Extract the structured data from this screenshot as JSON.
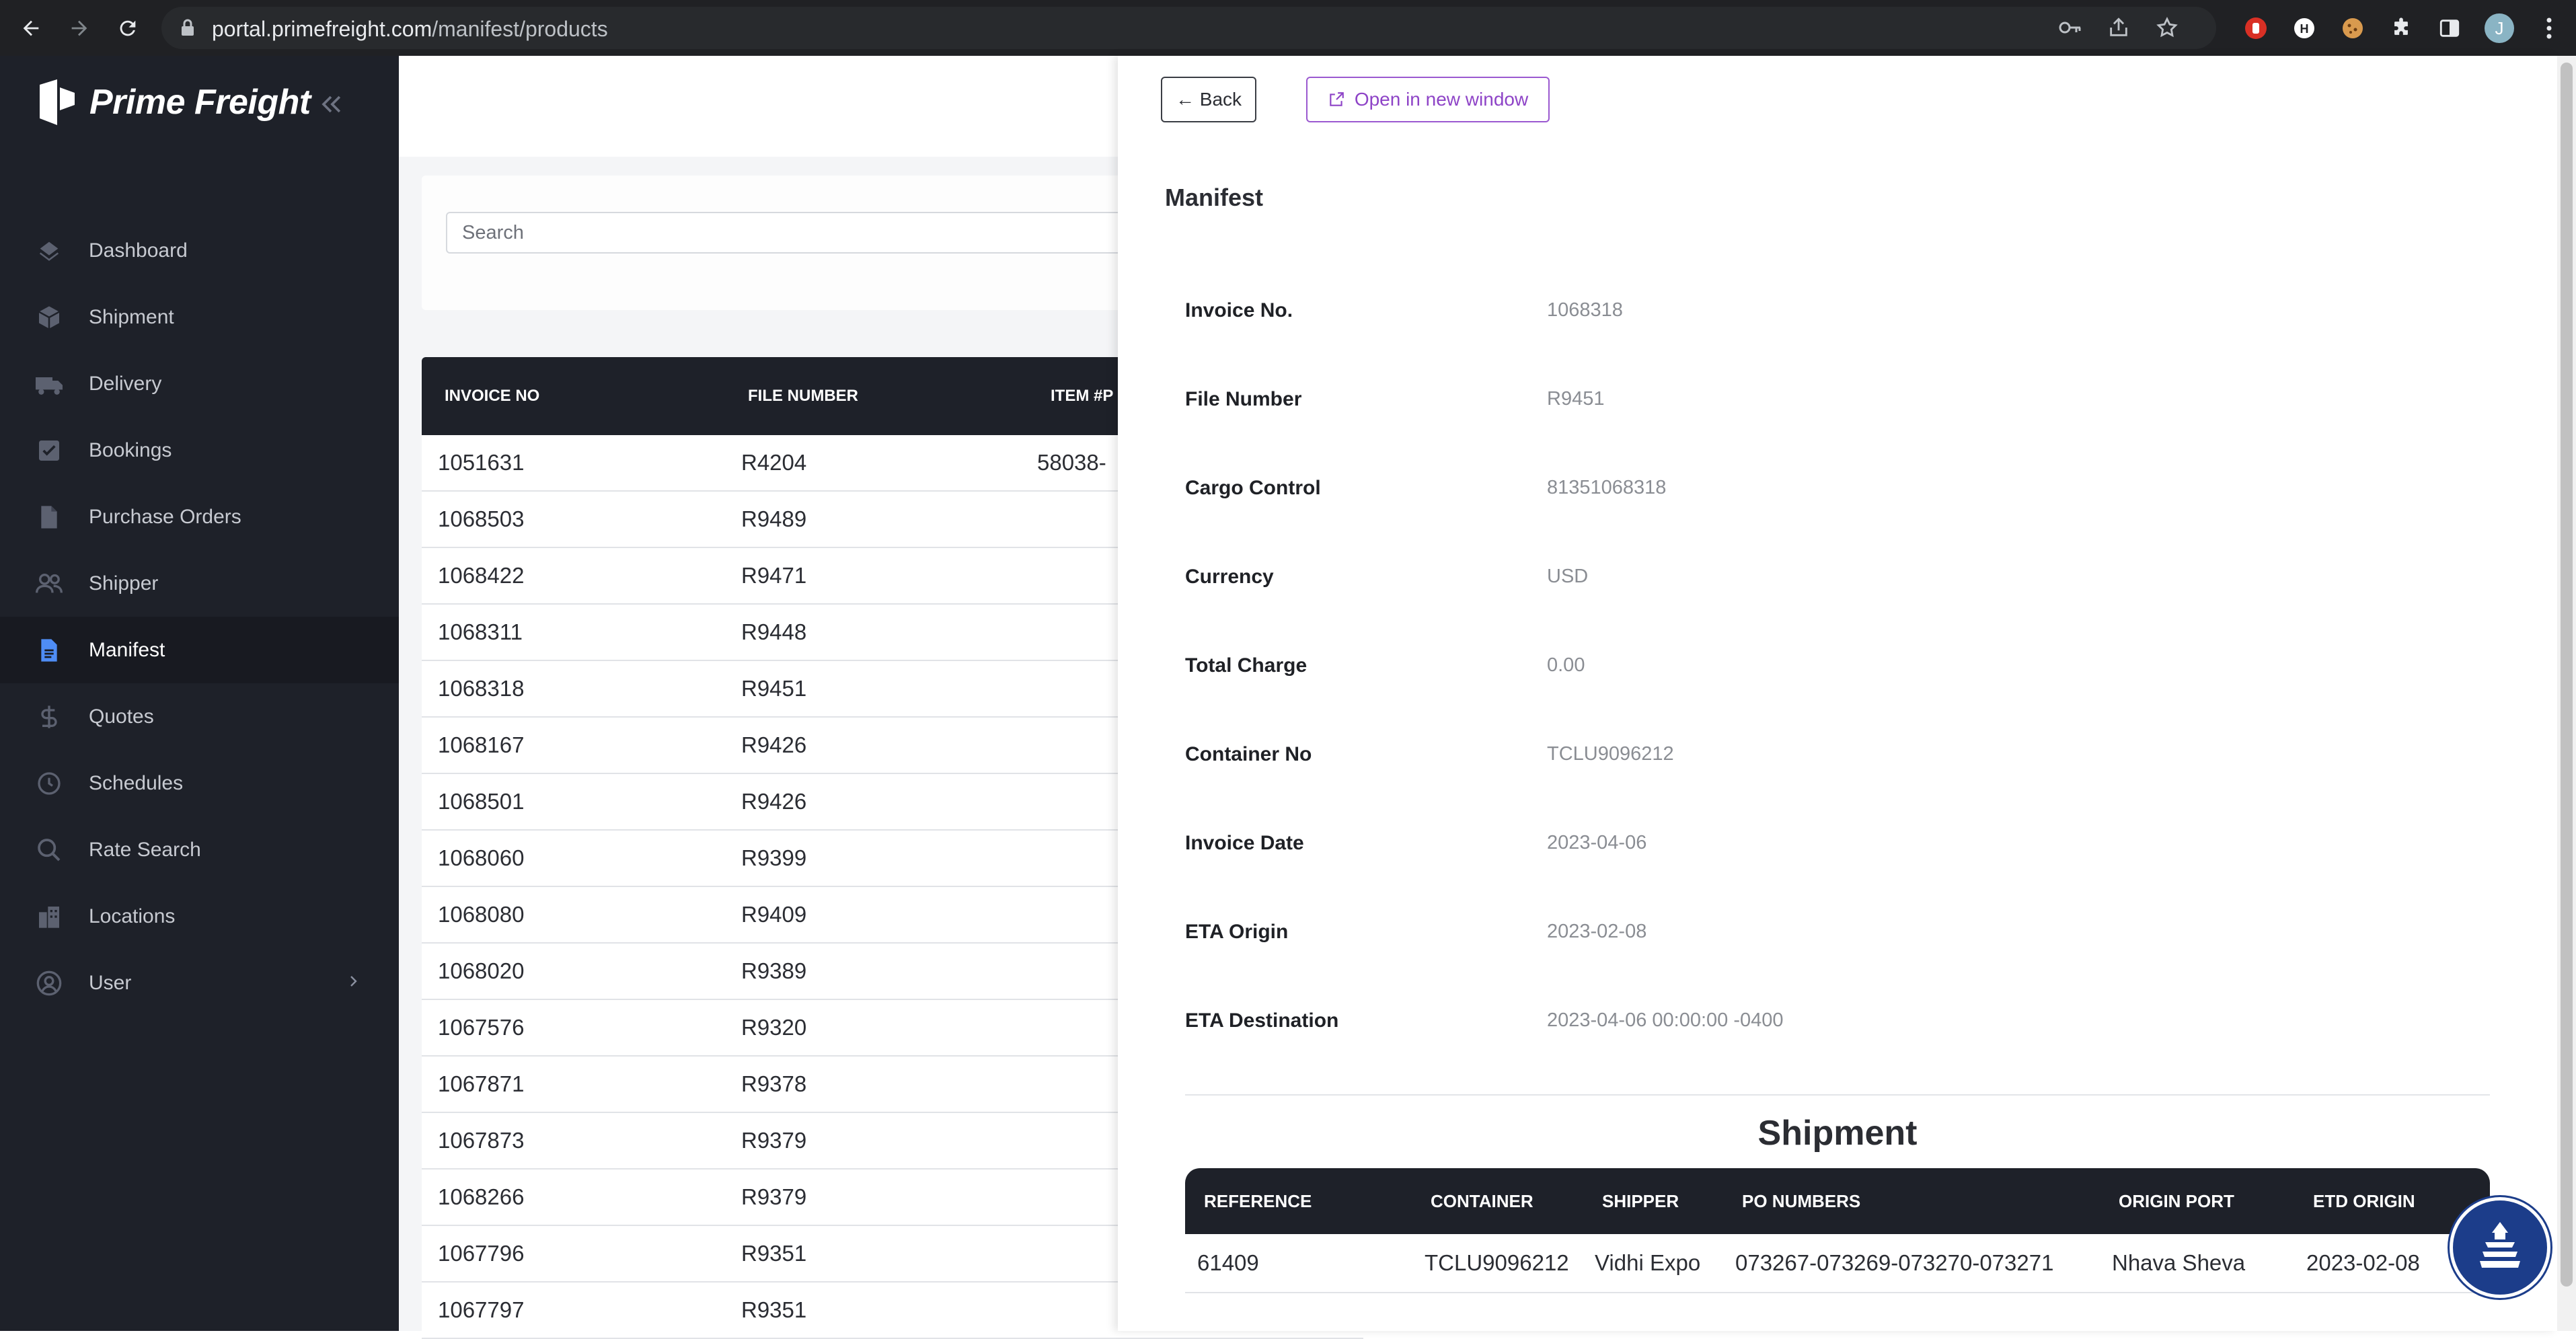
{
  "browser": {
    "url_host": "portal.primefreight.com",
    "url_path": "/manifest/products",
    "avatar_letter": "J"
  },
  "sidebar": {
    "brand": "Prime Freight",
    "items": [
      {
        "label": "Dashboard",
        "icon": "dashboard-icon"
      },
      {
        "label": "Shipment",
        "icon": "box-icon"
      },
      {
        "label": "Delivery",
        "icon": "truck-icon"
      },
      {
        "label": "Bookings",
        "icon": "checkbox-icon"
      },
      {
        "label": "Purchase Orders",
        "icon": "document-icon"
      },
      {
        "label": "Shipper",
        "icon": "users-icon"
      },
      {
        "label": "Manifest",
        "icon": "file-text-icon",
        "active": true
      },
      {
        "label": "Quotes",
        "icon": "dollar-icon"
      },
      {
        "label": "Schedules",
        "icon": "clock-icon"
      },
      {
        "label": "Rate Search",
        "icon": "search-icon"
      },
      {
        "label": "Locations",
        "icon": "buildings-icon"
      },
      {
        "label": "User",
        "icon": "user-circle-icon"
      }
    ]
  },
  "search": {
    "placeholder": "Search"
  },
  "list": {
    "columns": [
      "INVOICE NO",
      "FILE NUMBER",
      "ITEM #P"
    ],
    "rows": [
      [
        "1051631",
        "R4204",
        "58038-"
      ],
      [
        "1068503",
        "R9489",
        ""
      ],
      [
        "1068422",
        "R9471",
        ""
      ],
      [
        "1068311",
        "R9448",
        ""
      ],
      [
        "1068318",
        "R9451",
        ""
      ],
      [
        "1068167",
        "R9426",
        ""
      ],
      [
        "1068501",
        "R9426",
        ""
      ],
      [
        "1068060",
        "R9399",
        ""
      ],
      [
        "1068080",
        "R9409",
        ""
      ],
      [
        "1068020",
        "R9389",
        ""
      ],
      [
        "1067576",
        "R9320",
        ""
      ],
      [
        "1067871",
        "R9378",
        ""
      ],
      [
        "1067873",
        "R9379",
        ""
      ],
      [
        "1068266",
        "R9379",
        ""
      ],
      [
        "1067796",
        "R9351",
        ""
      ],
      [
        "1067797",
        "R9351",
        ""
      ]
    ]
  },
  "drawer": {
    "back_label": "← Back",
    "open_label": "Open in new window",
    "title": "Manifest",
    "fields": [
      {
        "key": "Invoice No.",
        "value": "1068318"
      },
      {
        "key": "File Number",
        "value": "R9451"
      },
      {
        "key": "Cargo Control",
        "value": "81351068318"
      },
      {
        "key": "Currency",
        "value": "USD"
      },
      {
        "key": "Total Charge",
        "value": "0.00"
      },
      {
        "key": "Container No",
        "value": "TCLU9096212"
      },
      {
        "key": "Invoice Date",
        "value": "2023-04-06"
      },
      {
        "key": "ETA Origin",
        "value": "2023-02-08"
      },
      {
        "key": "ETA Destination",
        "value": "2023-04-06 00:00:00 -0400"
      }
    ],
    "shipment": {
      "title": "Shipment",
      "columns": [
        "REFERENCE",
        "CONTAINER",
        "SHIPPER",
        "PO NUMBERS",
        "ORIGIN PORT",
        "ETD ORIGIN"
      ],
      "rows": [
        [
          "61409",
          "TCLU9096212",
          "Vidhi Expo",
          "073267-073269-073270-073271",
          "Nhava Sheva",
          "2023-02-08"
        ]
      ]
    }
  },
  "colors": {
    "sidebar_bg": "#1e2129",
    "accent_purple": "#8e44c7",
    "support_bg": "#1c3d8a"
  }
}
